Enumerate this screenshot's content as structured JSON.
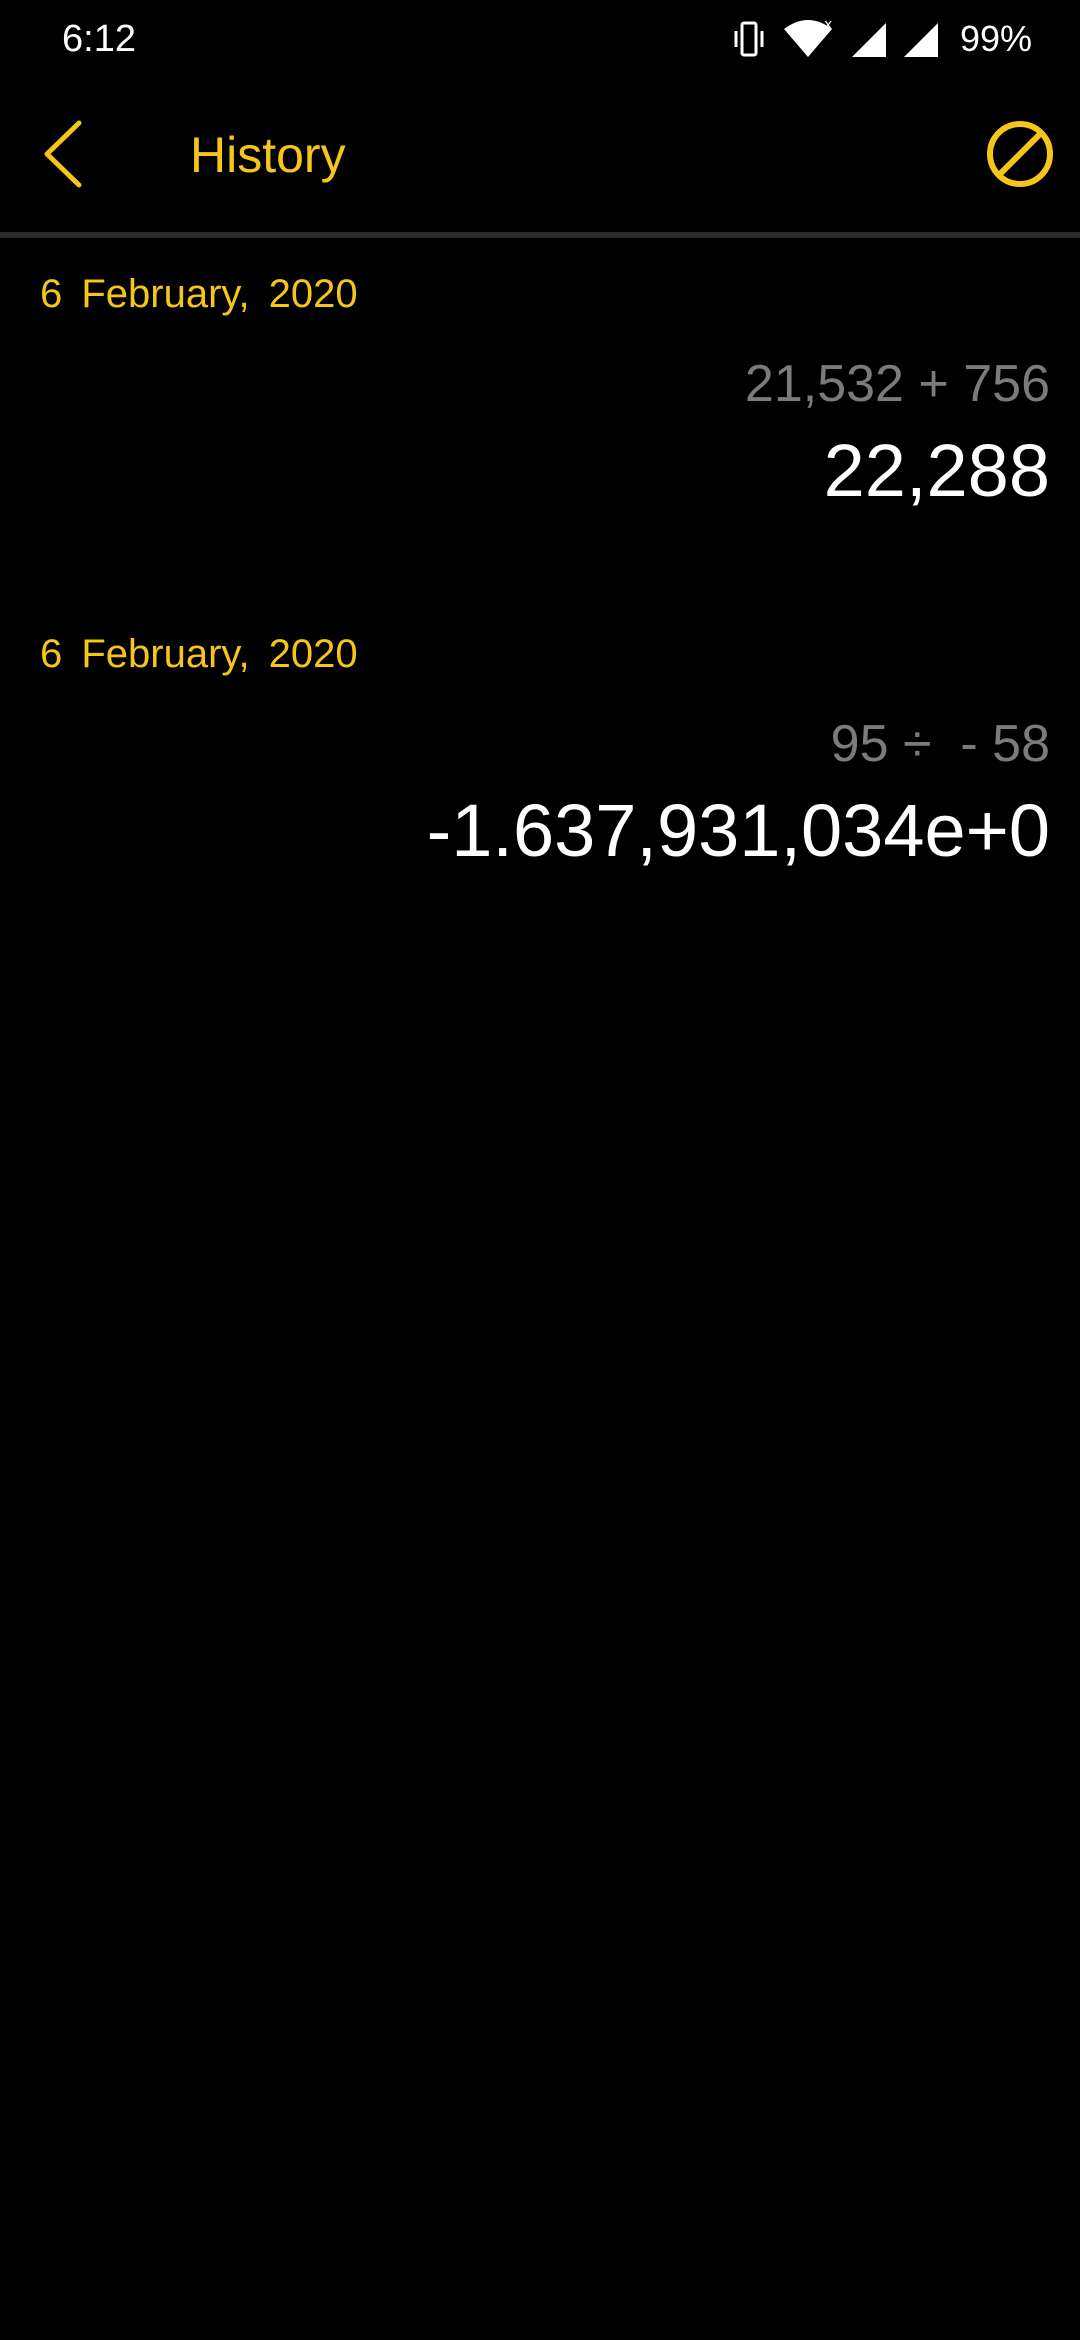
{
  "status_bar": {
    "time": "6:12",
    "battery": "99%",
    "icons": [
      "vibrate-icon",
      "wifi-icon",
      "signal-icon",
      "signal-icon"
    ]
  },
  "app_bar": {
    "title": "History",
    "back_icon": "chevron-left-icon",
    "clear_icon": "clear-history-icon"
  },
  "colors": {
    "accent": "#F5C518",
    "background": "#000000",
    "expression": "#7b7b7b",
    "result": "#ffffff"
  },
  "history": [
    {
      "date": "6  February,  2020",
      "expression": "21,532 + 756",
      "result": "22,288"
    },
    {
      "date": "6  February,  2020",
      "expression": "95 ÷  - 58",
      "result": "-1.637,931,034e+0"
    }
  ]
}
